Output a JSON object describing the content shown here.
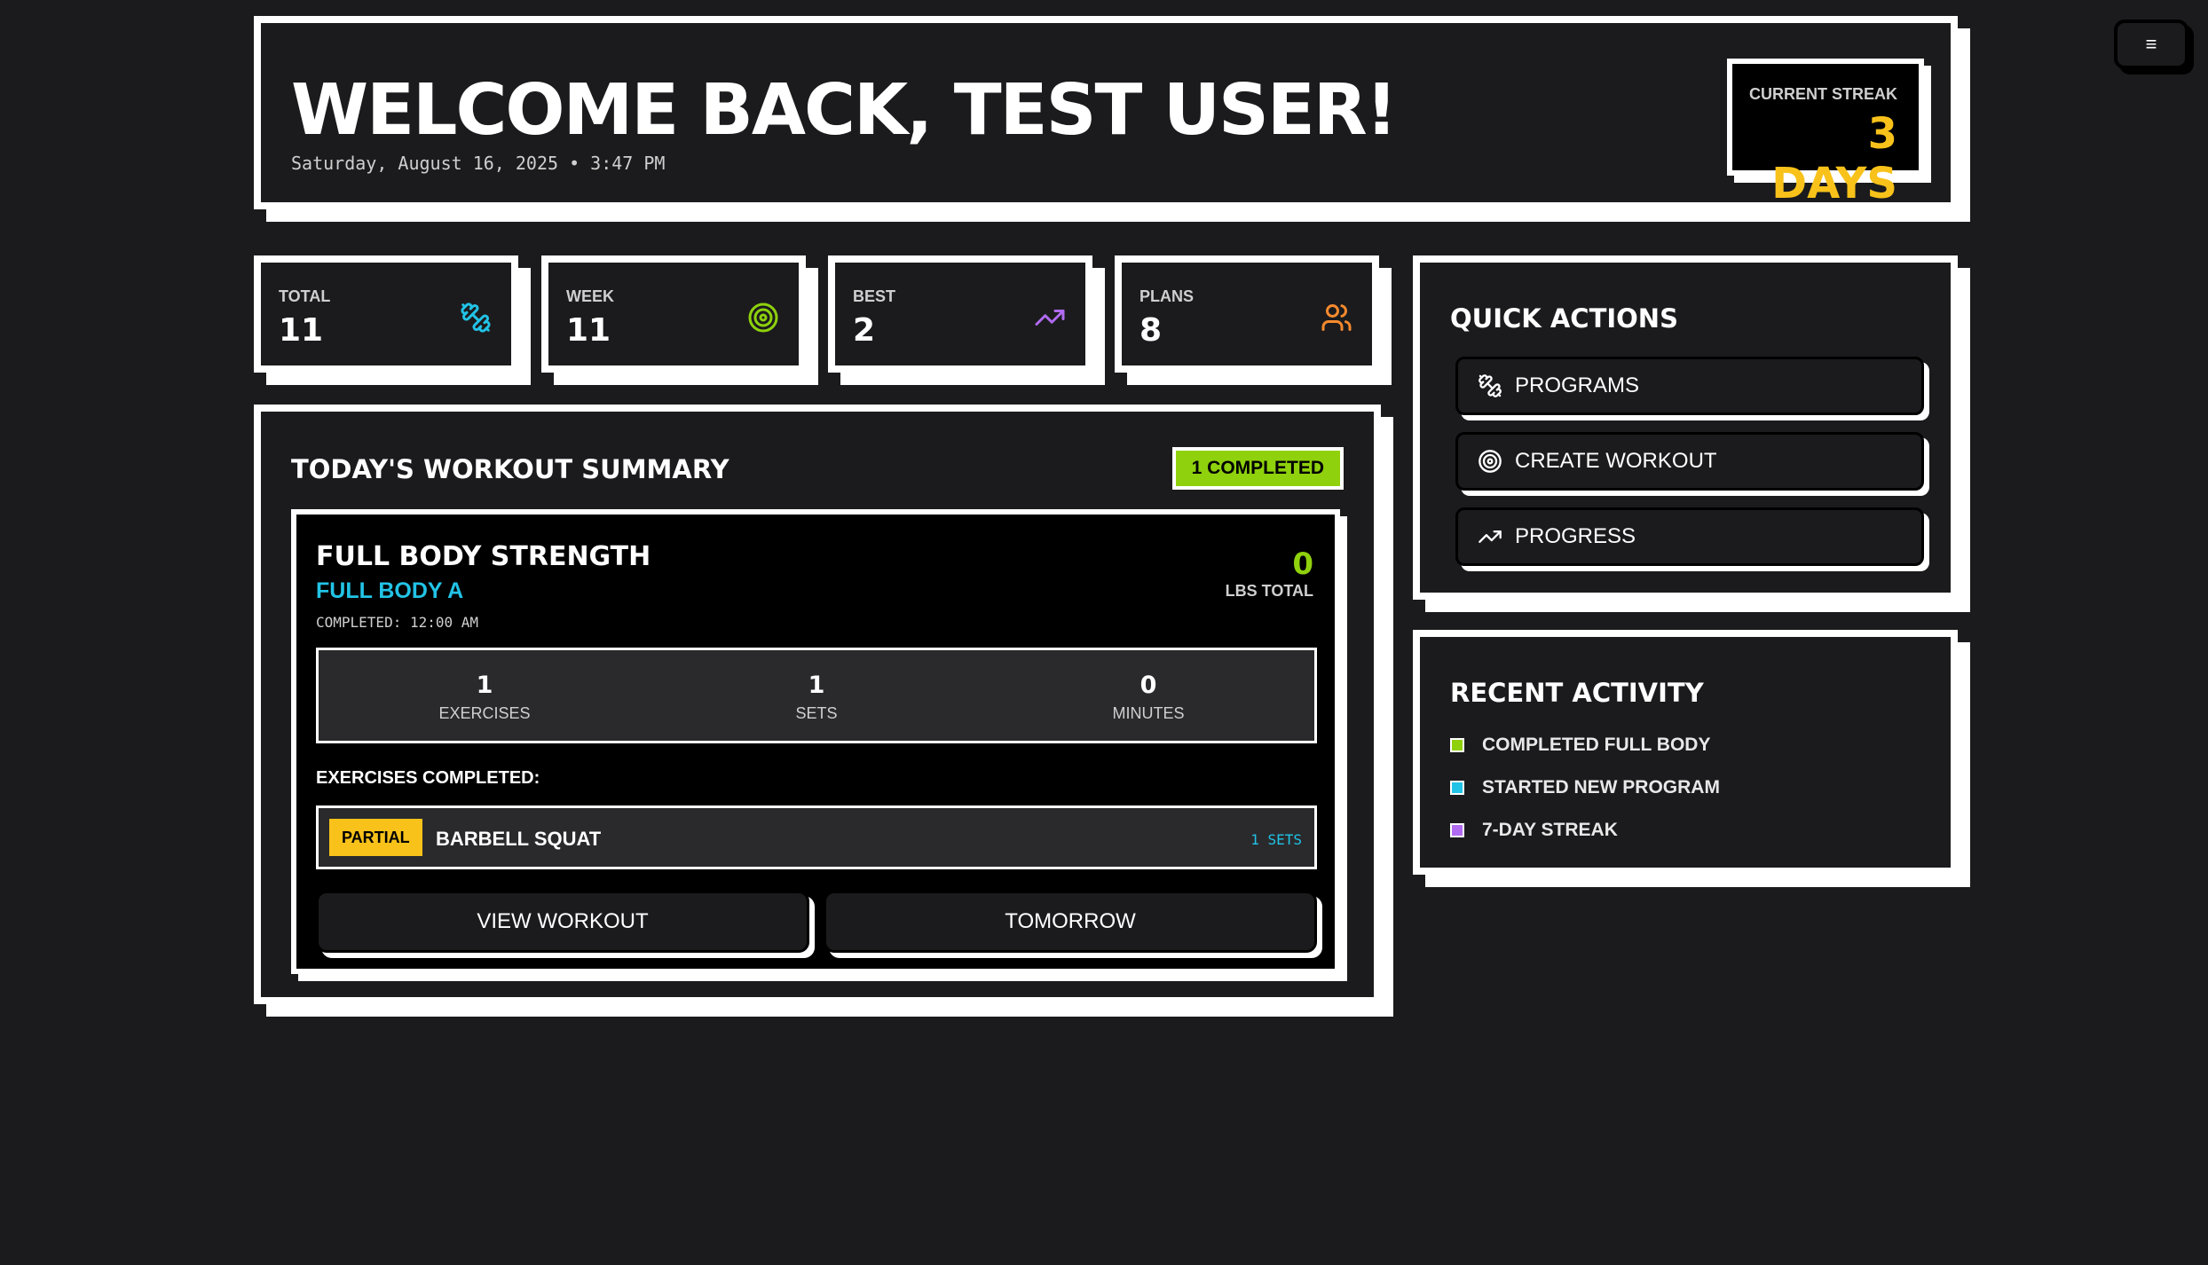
{
  "header": {
    "title": "WELCOME BACK, TEST USER!",
    "datetime": "Saturday, August 16, 2025 • 3:47 PM",
    "streak_label": "CURRENT STREAK",
    "streak_value": "3 DAYS"
  },
  "menu_button": "≡",
  "stats": [
    {
      "label": "TOTAL",
      "value": "11",
      "icon": "dumbbell-icon",
      "color": "#22c3e6"
    },
    {
      "label": "WEEK",
      "value": "11",
      "icon": "target-icon",
      "color": "#8fd10d"
    },
    {
      "label": "BEST",
      "value": "2",
      "icon": "trending-up-icon",
      "color": "#b06bf0"
    },
    {
      "label": "PLANS",
      "value": "8",
      "icon": "users-icon",
      "color": "#f58a2e"
    }
  ],
  "summary": {
    "title": "TODAY'S WORKOUT SUMMARY",
    "badge": "1 COMPLETED",
    "workout": {
      "name": "FULL BODY STRENGTH",
      "subtitle": "FULL BODY A",
      "completed": "COMPLETED: 12:00 AM",
      "lbs_value": "0",
      "lbs_label": "LBS TOTAL",
      "counts": [
        {
          "value": "1",
          "label": "EXERCISES"
        },
        {
          "value": "1",
          "label": "SETS"
        },
        {
          "value": "0",
          "label": "MINUTES"
        }
      ],
      "exercises_heading": "EXERCISES COMPLETED:",
      "exercise": {
        "status": "PARTIAL",
        "name": "BARBELL SQUAT",
        "sets": "1 SETS"
      },
      "view_button": "VIEW WORKOUT",
      "tomorrow_button": "TOMORROW"
    }
  },
  "quick_actions": {
    "title": "QUICK ACTIONS",
    "items": [
      {
        "label": "PROGRAMS",
        "icon": "dumbbell-icon"
      },
      {
        "label": "CREATE WORKOUT",
        "icon": "target-icon"
      },
      {
        "label": "PROGRESS",
        "icon": "trending-up-icon"
      }
    ]
  },
  "recent_activity": {
    "title": "RECENT ACTIVITY",
    "items": [
      {
        "label": "COMPLETED FULL BODY",
        "color": "#8fd10d"
      },
      {
        "label": "STARTED NEW PROGRAM",
        "color": "#22c3e6"
      },
      {
        "label": "7-DAY STREAK",
        "color": "#b06bf0"
      }
    ]
  },
  "colors": {
    "accent_green": "#8fd10d",
    "accent_yellow": "#f8c21a",
    "accent_cyan": "#22c3e6",
    "background": "#1b1b1d"
  }
}
